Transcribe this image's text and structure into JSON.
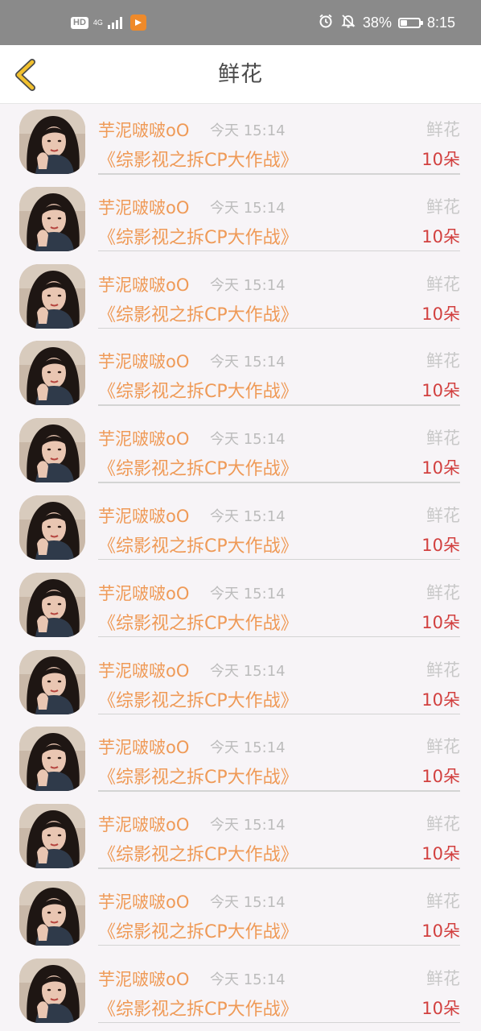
{
  "status_bar": {
    "hd": "HD",
    "network": "4G",
    "signal_bars": 4,
    "icons": [
      "hd-icon",
      "signal-icon",
      "app-notification-icon",
      "alarm-icon",
      "mute-icon",
      "battery-icon"
    ],
    "battery_pct": "38%",
    "battery_level": 0.38,
    "time": "8:15"
  },
  "nav": {
    "title": "鲜花",
    "back_icon": "chevron-left-icon",
    "accent": "#f2c12e"
  },
  "colors": {
    "username": "#ef9a57",
    "time": "#bcbcbc",
    "gift_type": "#c8c8c8",
    "gift_count": "#d2403f"
  },
  "items": [
    {
      "username": "芋泥啵啵oO",
      "time": "今天 15:14",
      "book": "《综影视之拆CP大作战》",
      "gift_type": "鲜花",
      "gift_count": "10朵"
    },
    {
      "username": "芋泥啵啵oO",
      "time": "今天 15:14",
      "book": "《综影视之拆CP大作战》",
      "gift_type": "鲜花",
      "gift_count": "10朵"
    },
    {
      "username": "芋泥啵啵oO",
      "time": "今天 15:14",
      "book": "《综影视之拆CP大作战》",
      "gift_type": "鲜花",
      "gift_count": "10朵"
    },
    {
      "username": "芋泥啵啵oO",
      "time": "今天 15:14",
      "book": "《综影视之拆CP大作战》",
      "gift_type": "鲜花",
      "gift_count": "10朵"
    },
    {
      "username": "芋泥啵啵oO",
      "time": "今天 15:14",
      "book": "《综影视之拆CP大作战》",
      "gift_type": "鲜花",
      "gift_count": "10朵"
    },
    {
      "username": "芋泥啵啵oO",
      "time": "今天 15:14",
      "book": "《综影视之拆CP大作战》",
      "gift_type": "鲜花",
      "gift_count": "10朵"
    },
    {
      "username": "芋泥啵啵oO",
      "time": "今天 15:14",
      "book": "《综影视之拆CP大作战》",
      "gift_type": "鲜花",
      "gift_count": "10朵"
    },
    {
      "username": "芋泥啵啵oO",
      "time": "今天 15:14",
      "book": "《综影视之拆CP大作战》",
      "gift_type": "鲜花",
      "gift_count": "10朵"
    },
    {
      "username": "芋泥啵啵oO",
      "time": "今天 15:14",
      "book": "《综影视之拆CP大作战》",
      "gift_type": "鲜花",
      "gift_count": "10朵"
    },
    {
      "username": "芋泥啵啵oO",
      "time": "今天 15:14",
      "book": "《综影视之拆CP大作战》",
      "gift_type": "鲜花",
      "gift_count": "10朵"
    },
    {
      "username": "芋泥啵啵oO",
      "time": "今天 15:14",
      "book": "《综影视之拆CP大作战》",
      "gift_type": "鲜花",
      "gift_count": "10朵"
    },
    {
      "username": "芋泥啵啵oO",
      "time": "今天 15:14",
      "book": "《综影视之拆CP大作战》",
      "gift_type": "鲜花",
      "gift_count": "10朵"
    }
  ]
}
